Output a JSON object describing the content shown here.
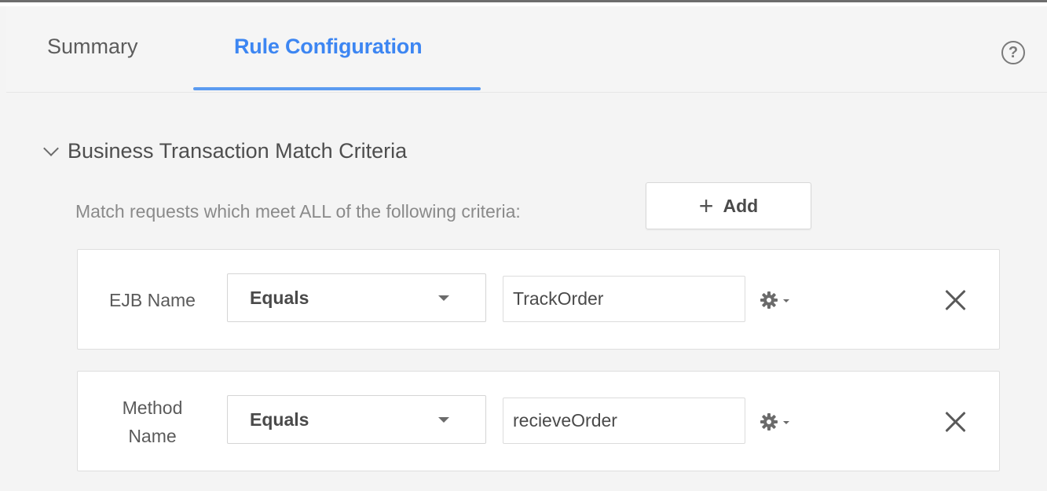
{
  "tabs": [
    {
      "label": "Summary",
      "active": false
    },
    {
      "label": "Rule Configuration",
      "active": true
    }
  ],
  "help": {
    "icon": "help-icon",
    "glyph": "?"
  },
  "section": {
    "title": "Business Transaction Match Criteria",
    "expanded": true,
    "description": "Match requests which meet ALL of the following criteria:",
    "add_button": {
      "plus": "+",
      "label": "Add"
    }
  },
  "criteria": [
    {
      "label": "EJB Name",
      "operator": "Equals",
      "value": "TrackOrder"
    },
    {
      "label": "Method Name",
      "operator": "Equals",
      "value": "recieveOrder"
    }
  ],
  "colors": {
    "accent": "#3d86f2",
    "text": "#4a4a4a",
    "background": "#f4f4f4"
  }
}
